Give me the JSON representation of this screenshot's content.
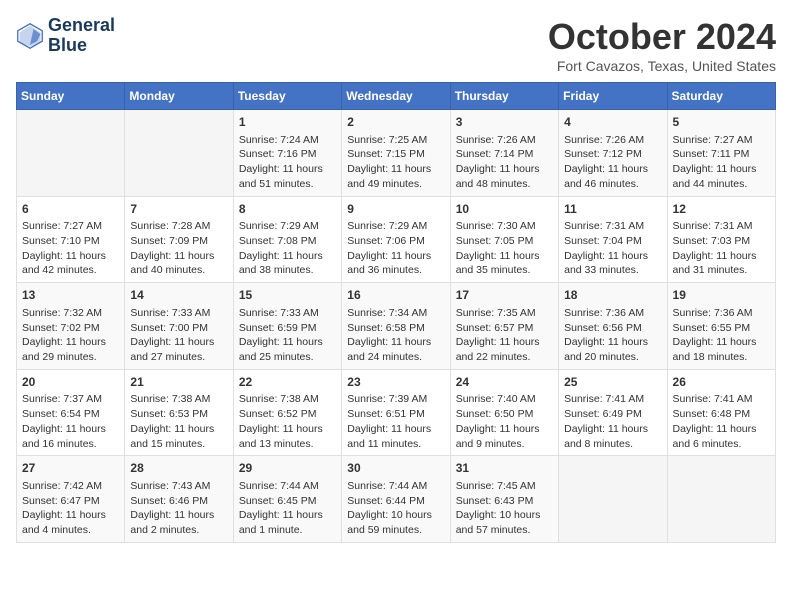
{
  "header": {
    "logo_line1": "General",
    "logo_line2": "Blue",
    "month_title": "October 2024",
    "location": "Fort Cavazos, Texas, United States"
  },
  "days_of_week": [
    "Sunday",
    "Monday",
    "Tuesday",
    "Wednesday",
    "Thursday",
    "Friday",
    "Saturday"
  ],
  "weeks": [
    [
      {
        "day": "",
        "content": ""
      },
      {
        "day": "",
        "content": ""
      },
      {
        "day": "1",
        "content": "Sunrise: 7:24 AM\nSunset: 7:16 PM\nDaylight: 11 hours and 51 minutes."
      },
      {
        "day": "2",
        "content": "Sunrise: 7:25 AM\nSunset: 7:15 PM\nDaylight: 11 hours and 49 minutes."
      },
      {
        "day": "3",
        "content": "Sunrise: 7:26 AM\nSunset: 7:14 PM\nDaylight: 11 hours and 48 minutes."
      },
      {
        "day": "4",
        "content": "Sunrise: 7:26 AM\nSunset: 7:12 PM\nDaylight: 11 hours and 46 minutes."
      },
      {
        "day": "5",
        "content": "Sunrise: 7:27 AM\nSunset: 7:11 PM\nDaylight: 11 hours and 44 minutes."
      }
    ],
    [
      {
        "day": "6",
        "content": "Sunrise: 7:27 AM\nSunset: 7:10 PM\nDaylight: 11 hours and 42 minutes."
      },
      {
        "day": "7",
        "content": "Sunrise: 7:28 AM\nSunset: 7:09 PM\nDaylight: 11 hours and 40 minutes."
      },
      {
        "day": "8",
        "content": "Sunrise: 7:29 AM\nSunset: 7:08 PM\nDaylight: 11 hours and 38 minutes."
      },
      {
        "day": "9",
        "content": "Sunrise: 7:29 AM\nSunset: 7:06 PM\nDaylight: 11 hours and 36 minutes."
      },
      {
        "day": "10",
        "content": "Sunrise: 7:30 AM\nSunset: 7:05 PM\nDaylight: 11 hours and 35 minutes."
      },
      {
        "day": "11",
        "content": "Sunrise: 7:31 AM\nSunset: 7:04 PM\nDaylight: 11 hours and 33 minutes."
      },
      {
        "day": "12",
        "content": "Sunrise: 7:31 AM\nSunset: 7:03 PM\nDaylight: 11 hours and 31 minutes."
      }
    ],
    [
      {
        "day": "13",
        "content": "Sunrise: 7:32 AM\nSunset: 7:02 PM\nDaylight: 11 hours and 29 minutes."
      },
      {
        "day": "14",
        "content": "Sunrise: 7:33 AM\nSunset: 7:00 PM\nDaylight: 11 hours and 27 minutes."
      },
      {
        "day": "15",
        "content": "Sunrise: 7:33 AM\nSunset: 6:59 PM\nDaylight: 11 hours and 25 minutes."
      },
      {
        "day": "16",
        "content": "Sunrise: 7:34 AM\nSunset: 6:58 PM\nDaylight: 11 hours and 24 minutes."
      },
      {
        "day": "17",
        "content": "Sunrise: 7:35 AM\nSunset: 6:57 PM\nDaylight: 11 hours and 22 minutes."
      },
      {
        "day": "18",
        "content": "Sunrise: 7:36 AM\nSunset: 6:56 PM\nDaylight: 11 hours and 20 minutes."
      },
      {
        "day": "19",
        "content": "Sunrise: 7:36 AM\nSunset: 6:55 PM\nDaylight: 11 hours and 18 minutes."
      }
    ],
    [
      {
        "day": "20",
        "content": "Sunrise: 7:37 AM\nSunset: 6:54 PM\nDaylight: 11 hours and 16 minutes."
      },
      {
        "day": "21",
        "content": "Sunrise: 7:38 AM\nSunset: 6:53 PM\nDaylight: 11 hours and 15 minutes."
      },
      {
        "day": "22",
        "content": "Sunrise: 7:38 AM\nSunset: 6:52 PM\nDaylight: 11 hours and 13 minutes."
      },
      {
        "day": "23",
        "content": "Sunrise: 7:39 AM\nSunset: 6:51 PM\nDaylight: 11 hours and 11 minutes."
      },
      {
        "day": "24",
        "content": "Sunrise: 7:40 AM\nSunset: 6:50 PM\nDaylight: 11 hours and 9 minutes."
      },
      {
        "day": "25",
        "content": "Sunrise: 7:41 AM\nSunset: 6:49 PM\nDaylight: 11 hours and 8 minutes."
      },
      {
        "day": "26",
        "content": "Sunrise: 7:41 AM\nSunset: 6:48 PM\nDaylight: 11 hours and 6 minutes."
      }
    ],
    [
      {
        "day": "27",
        "content": "Sunrise: 7:42 AM\nSunset: 6:47 PM\nDaylight: 11 hours and 4 minutes."
      },
      {
        "day": "28",
        "content": "Sunrise: 7:43 AM\nSunset: 6:46 PM\nDaylight: 11 hours and 2 minutes."
      },
      {
        "day": "29",
        "content": "Sunrise: 7:44 AM\nSunset: 6:45 PM\nDaylight: 11 hours and 1 minute."
      },
      {
        "day": "30",
        "content": "Sunrise: 7:44 AM\nSunset: 6:44 PM\nDaylight: 10 hours and 59 minutes."
      },
      {
        "day": "31",
        "content": "Sunrise: 7:45 AM\nSunset: 6:43 PM\nDaylight: 10 hours and 57 minutes."
      },
      {
        "day": "",
        "content": ""
      },
      {
        "day": "",
        "content": ""
      }
    ]
  ]
}
